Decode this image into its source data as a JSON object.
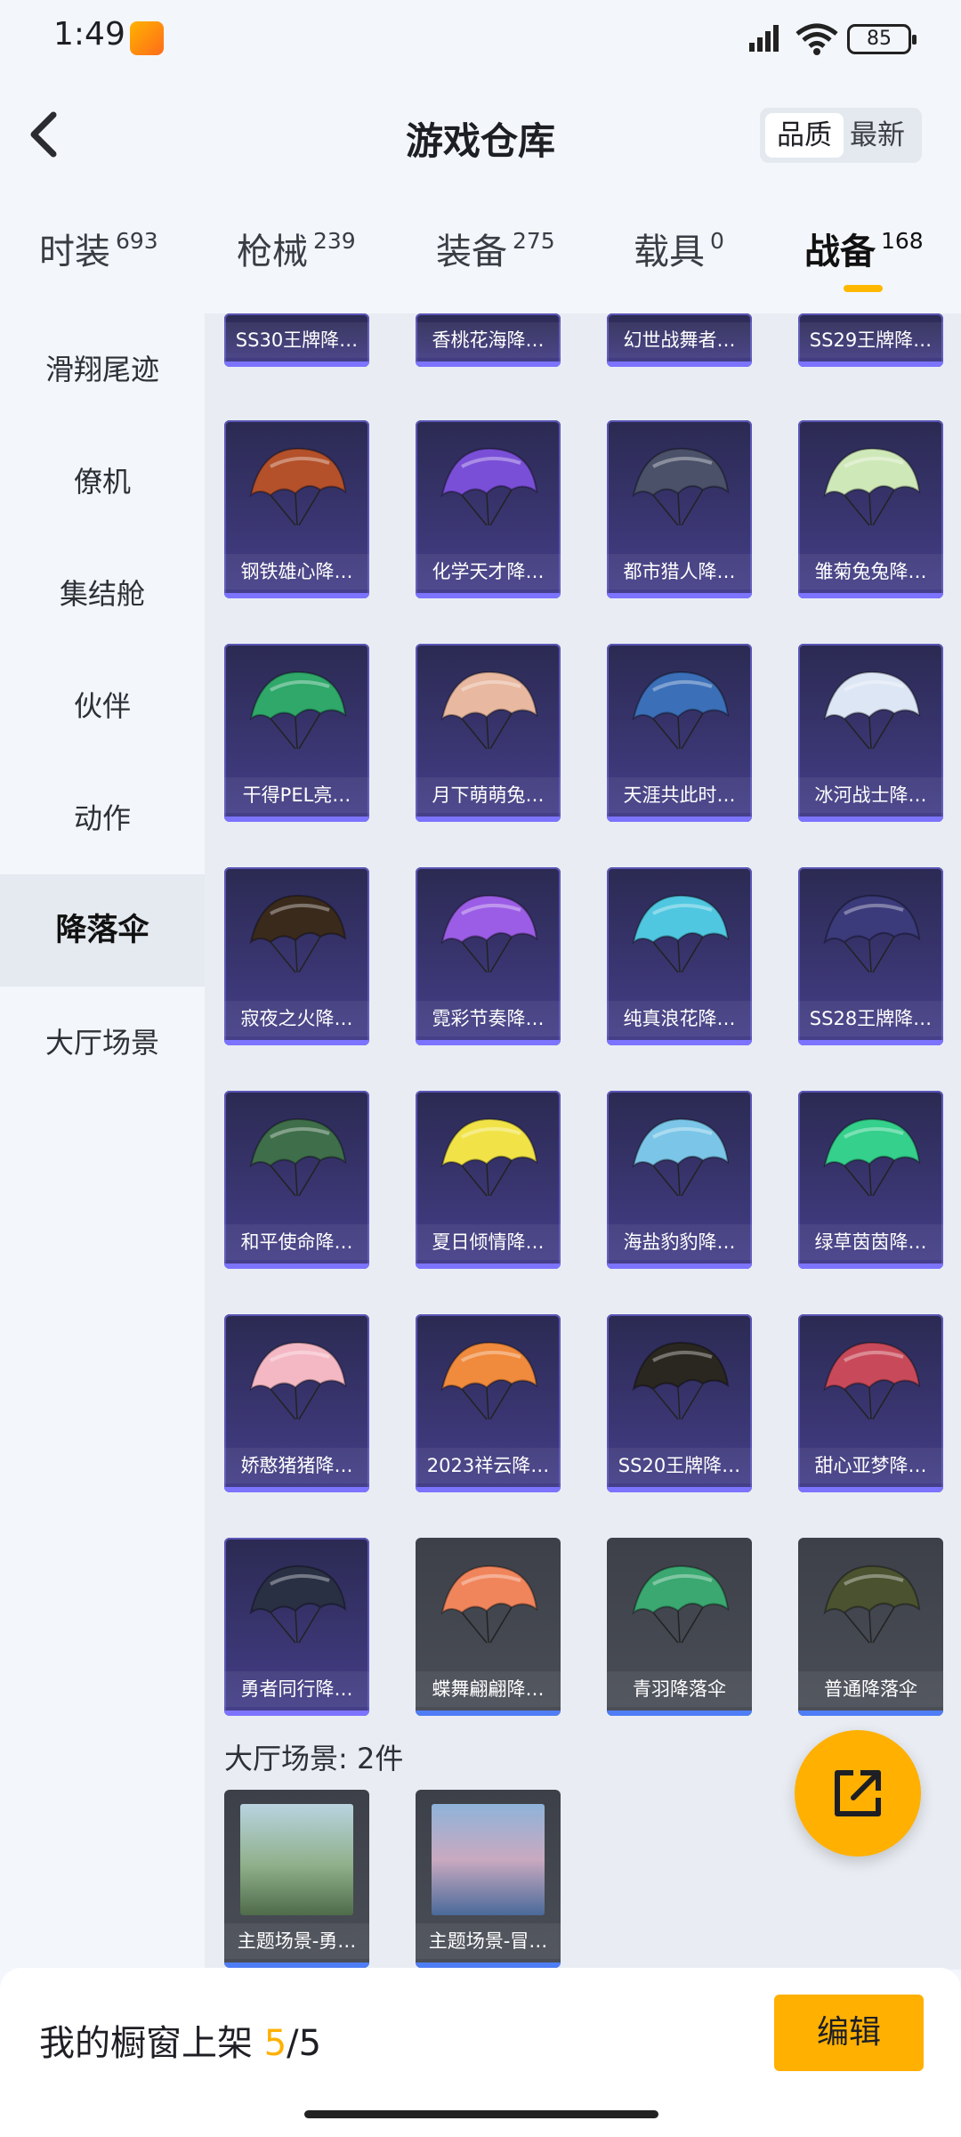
{
  "status": {
    "time": "1:49",
    "battery": "85"
  },
  "header": {
    "title": "游戏仓库",
    "sort_quality": "品质",
    "sort_latest": "最新"
  },
  "tabs": [
    {
      "label": "时装",
      "count": "693"
    },
    {
      "label": "枪械",
      "count": "239"
    },
    {
      "label": "装备",
      "count": "275"
    },
    {
      "label": "载具",
      "count": "0"
    },
    {
      "label": "战备",
      "count": "168"
    }
  ],
  "sidebar": [
    "滑翔尾迹",
    "僚机",
    "集结舱",
    "伙伴",
    "动作",
    "降落伞",
    "大厅场景"
  ],
  "partial_items": [
    "SS30王牌降…",
    "香桃花海降…",
    "幻世战舞者…",
    "SS29王牌降…"
  ],
  "items": [
    {
      "name": "钢铁雄心降…",
      "color": "#b4512a",
      "tier": "purple"
    },
    {
      "name": "化学天才降…",
      "color": "#7a4fd8",
      "tier": "purple"
    },
    {
      "name": "都市猎人降…",
      "color": "#4a5168",
      "tier": "purple"
    },
    {
      "name": "雏菊兔兔降…",
      "color": "#cfe8b8",
      "tier": "purple"
    },
    {
      "name": "干得PEL亮…",
      "color": "#2fa86a",
      "tier": "purple"
    },
    {
      "name": "月下萌萌兔…",
      "color": "#e8b8a0",
      "tier": "purple"
    },
    {
      "name": "天涯共此时…",
      "color": "#3b6fb8",
      "tier": "purple"
    },
    {
      "name": "冰河战士降…",
      "color": "#dde6f5",
      "tier": "purple"
    },
    {
      "name": "寂夜之火降…",
      "color": "#3a2a1c",
      "tier": "purple"
    },
    {
      "name": "霓彩节奏降…",
      "color": "#9b5de5",
      "tier": "purple"
    },
    {
      "name": "纯真浪花降…",
      "color": "#4fc7e0",
      "tier": "purple"
    },
    {
      "name": "SS28王牌降…",
      "color": "#3b3a7a",
      "tier": "purple"
    },
    {
      "name": "和平使命降…",
      "color": "#3f6e4a",
      "tier": "purple"
    },
    {
      "name": "夏日倾情降…",
      "color": "#f1e347",
      "tier": "purple"
    },
    {
      "name": "海盐豹豹降…",
      "color": "#7bc6e8",
      "tier": "purple"
    },
    {
      "name": "绿草茵茵降…",
      "color": "#34d08c",
      "tier": "purple"
    },
    {
      "name": "娇憨猪猪降…",
      "color": "#f4b8c4",
      "tier": "purple"
    },
    {
      "name": "2023祥云降…",
      "color": "#f08a3c",
      "tier": "purple"
    },
    {
      "name": "SS20王牌降…",
      "color": "#2a2620",
      "tier": "purple"
    },
    {
      "name": "甜心亚梦降…",
      "color": "#c84a5a",
      "tier": "purple"
    },
    {
      "name": "勇者同行降…",
      "color": "#2a3044",
      "tier": "purple"
    },
    {
      "name": "蝶舞翩翩降…",
      "color": "#f0855c",
      "tier": "grey"
    },
    {
      "name": "青羽降落伞",
      "color": "#3aa870",
      "tier": "grey"
    },
    {
      "name": "普通降落伞",
      "color": "#4a5230",
      "tier": "grey"
    }
  ],
  "scene_section": {
    "label": "大厅场景: 2件"
  },
  "scenes": [
    {
      "name": "主题场景-勇…",
      "color": "#6f8f70"
    },
    {
      "name": "主题场景-冒…",
      "color": "#7d8fb8"
    }
  ],
  "bottom": {
    "label": "我的橱窗上架 ",
    "current": "5",
    "total": "/5",
    "edit": "编辑"
  }
}
